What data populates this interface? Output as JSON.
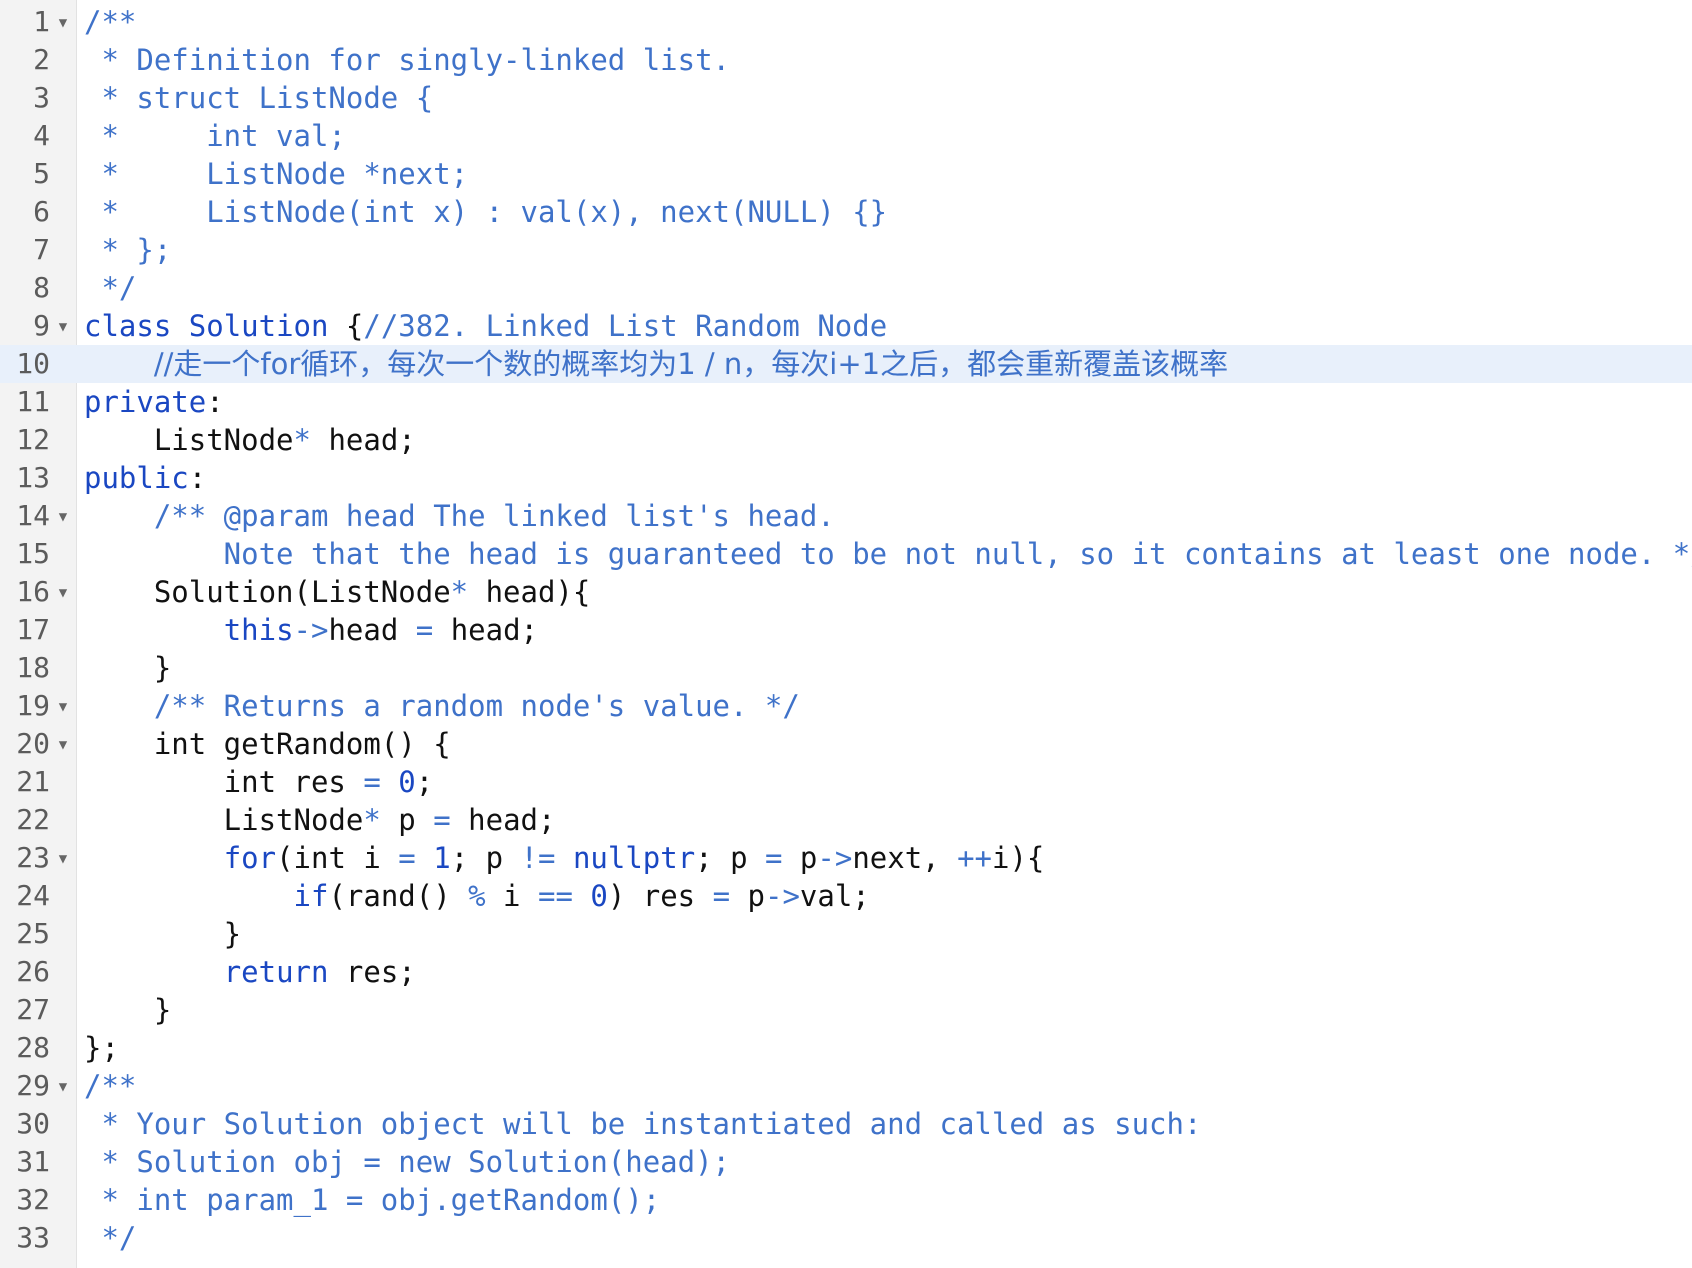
{
  "editor": {
    "active_line": 10,
    "colors": {
      "gutter_bg": "#f3f3f3",
      "active_line_bg": "#e8f0fb",
      "comment": "#3f72c9",
      "keyword": "#1a47c2",
      "text": "#111111",
      "line_number": "#5b5b5b"
    },
    "fold_icon": "chevron-down-icon",
    "fold_glyph": "▼",
    "lines": [
      {
        "n": "1",
        "fold": true,
        "tokens": [
          {
            "t": "/**",
            "c": "c"
          }
        ]
      },
      {
        "n": "2",
        "fold": false,
        "tokens": [
          {
            "t": " * Definition for singly-linked list.",
            "c": "c"
          }
        ]
      },
      {
        "n": "3",
        "fold": false,
        "tokens": [
          {
            "t": " * struct ListNode {",
            "c": "c"
          }
        ]
      },
      {
        "n": "4",
        "fold": false,
        "tokens": [
          {
            "t": " *     int val;",
            "c": "c"
          }
        ]
      },
      {
        "n": "5",
        "fold": false,
        "tokens": [
          {
            "t": " *     ListNode *next;",
            "c": "c"
          }
        ]
      },
      {
        "n": "6",
        "fold": false,
        "tokens": [
          {
            "t": " *     ListNode(int x) : val(x), next(NULL) {}",
            "c": "c"
          }
        ]
      },
      {
        "n": "7",
        "fold": false,
        "tokens": [
          {
            "t": " * };",
            "c": "c"
          }
        ]
      },
      {
        "n": "8",
        "fold": false,
        "tokens": [
          {
            "t": " */",
            "c": "c"
          }
        ]
      },
      {
        "n": "9",
        "fold": true,
        "tokens": [
          {
            "t": "class",
            "c": "k"
          },
          {
            "t": " ",
            "c": "p"
          },
          {
            "t": "Solution",
            "c": "t"
          },
          {
            "t": " {",
            "c": "p"
          },
          {
            "t": "//382. Linked List Random Node",
            "c": "c"
          }
        ]
      },
      {
        "n": "10",
        "fold": false,
        "tokens": [
          {
            "t": "    ",
            "c": "p"
          },
          {
            "t": "//走一个for循环，每次一个数的概率均为1 / n，每次i+1之后，都会重新覆盖该概率",
            "c": "c cjk"
          }
        ]
      },
      {
        "n": "11",
        "fold": false,
        "tokens": [
          {
            "t": "private",
            "c": "k"
          },
          {
            "t": ":",
            "c": "p"
          }
        ]
      },
      {
        "n": "12",
        "fold": false,
        "tokens": [
          {
            "t": "    ListNode",
            "c": "p"
          },
          {
            "t": "*",
            "c": "o"
          },
          {
            "t": " head;",
            "c": "p"
          }
        ]
      },
      {
        "n": "13",
        "fold": false,
        "tokens": [
          {
            "t": "public",
            "c": "k"
          },
          {
            "t": ":",
            "c": "p"
          }
        ]
      },
      {
        "n": "14",
        "fold": true,
        "tokens": [
          {
            "t": "    ",
            "c": "p"
          },
          {
            "t": "/** @param head The linked list's head.",
            "c": "c"
          }
        ]
      },
      {
        "n": "15",
        "fold": false,
        "tokens": [
          {
            "t": "        Note that the head is guaranteed to be not null, so it contains at least one node. */",
            "c": "c"
          }
        ]
      },
      {
        "n": "16",
        "fold": true,
        "tokens": [
          {
            "t": "    Solution(ListNode",
            "c": "p"
          },
          {
            "t": "*",
            "c": "o"
          },
          {
            "t": " head){",
            "c": "p"
          }
        ]
      },
      {
        "n": "17",
        "fold": false,
        "tokens": [
          {
            "t": "        ",
            "c": "p"
          },
          {
            "t": "this",
            "c": "k"
          },
          {
            "t": "->",
            "c": "o"
          },
          {
            "t": "head ",
            "c": "p"
          },
          {
            "t": "=",
            "c": "o"
          },
          {
            "t": " head;",
            "c": "p"
          }
        ]
      },
      {
        "n": "18",
        "fold": false,
        "tokens": [
          {
            "t": "    }",
            "c": "p"
          }
        ]
      },
      {
        "n": "19",
        "fold": true,
        "tokens": [
          {
            "t": "    ",
            "c": "p"
          },
          {
            "t": "/** Returns a random node's value. */",
            "c": "c"
          }
        ]
      },
      {
        "n": "20",
        "fold": true,
        "tokens": [
          {
            "t": "    int getRandom() {",
            "c": "p"
          }
        ]
      },
      {
        "n": "21",
        "fold": false,
        "tokens": [
          {
            "t": "        int res ",
            "c": "p"
          },
          {
            "t": "=",
            "c": "o"
          },
          {
            "t": " ",
            "c": "p"
          },
          {
            "t": "0",
            "c": "n"
          },
          {
            "t": ";",
            "c": "p"
          }
        ]
      },
      {
        "n": "22",
        "fold": false,
        "tokens": [
          {
            "t": "        ListNode",
            "c": "p"
          },
          {
            "t": "*",
            "c": "o"
          },
          {
            "t": " p ",
            "c": "p"
          },
          {
            "t": "=",
            "c": "o"
          },
          {
            "t": " head;",
            "c": "p"
          }
        ]
      },
      {
        "n": "23",
        "fold": true,
        "tokens": [
          {
            "t": "        ",
            "c": "p"
          },
          {
            "t": "for",
            "c": "k"
          },
          {
            "t": "(int i ",
            "c": "p"
          },
          {
            "t": "=",
            "c": "o"
          },
          {
            "t": " ",
            "c": "p"
          },
          {
            "t": "1",
            "c": "n"
          },
          {
            "t": "; p ",
            "c": "p"
          },
          {
            "t": "!=",
            "c": "o"
          },
          {
            "t": " ",
            "c": "p"
          },
          {
            "t": "nullptr",
            "c": "k"
          },
          {
            "t": "; p ",
            "c": "p"
          },
          {
            "t": "=",
            "c": "o"
          },
          {
            "t": " p",
            "c": "p"
          },
          {
            "t": "->",
            "c": "o"
          },
          {
            "t": "next, ",
            "c": "p"
          },
          {
            "t": "++",
            "c": "o"
          },
          {
            "t": "i){",
            "c": "p"
          }
        ]
      },
      {
        "n": "24",
        "fold": false,
        "tokens": [
          {
            "t": "            ",
            "c": "p"
          },
          {
            "t": "if",
            "c": "k"
          },
          {
            "t": "(rand() ",
            "c": "p"
          },
          {
            "t": "%",
            "c": "o"
          },
          {
            "t": " i ",
            "c": "p"
          },
          {
            "t": "==",
            "c": "o"
          },
          {
            "t": " ",
            "c": "p"
          },
          {
            "t": "0",
            "c": "n"
          },
          {
            "t": ") res ",
            "c": "p"
          },
          {
            "t": "=",
            "c": "o"
          },
          {
            "t": " p",
            "c": "p"
          },
          {
            "t": "->",
            "c": "o"
          },
          {
            "t": "val;",
            "c": "p"
          }
        ]
      },
      {
        "n": "25",
        "fold": false,
        "tokens": [
          {
            "t": "        }",
            "c": "p"
          }
        ]
      },
      {
        "n": "26",
        "fold": false,
        "tokens": [
          {
            "t": "        ",
            "c": "p"
          },
          {
            "t": "return",
            "c": "k"
          },
          {
            "t": " res;",
            "c": "p"
          }
        ]
      },
      {
        "n": "27",
        "fold": false,
        "tokens": [
          {
            "t": "    }",
            "c": "p"
          }
        ]
      },
      {
        "n": "28",
        "fold": false,
        "tokens": [
          {
            "t": "};",
            "c": "p"
          }
        ]
      },
      {
        "n": "29",
        "fold": true,
        "tokens": [
          {
            "t": "/**",
            "c": "c"
          }
        ]
      },
      {
        "n": "30",
        "fold": false,
        "tokens": [
          {
            "t": " * Your Solution object will be instantiated and called as such:",
            "c": "c"
          }
        ]
      },
      {
        "n": "31",
        "fold": false,
        "tokens": [
          {
            "t": " * Solution obj = new Solution(head);",
            "c": "c"
          }
        ]
      },
      {
        "n": "32",
        "fold": false,
        "tokens": [
          {
            "t": " * int param_1 = obj.getRandom();",
            "c": "c"
          }
        ]
      },
      {
        "n": "33",
        "fold": false,
        "tokens": [
          {
            "t": " */",
            "c": "c"
          }
        ]
      }
    ]
  }
}
